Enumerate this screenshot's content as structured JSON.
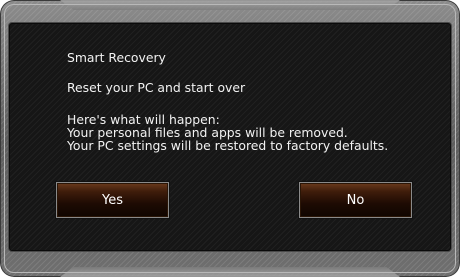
{
  "dialog": {
    "title": "Smart Recovery",
    "heading": "Reset your PC and start over",
    "lines": [
      "Here's what will happen:",
      "Your personal files and apps will be removed.",
      "Your PC settings will be restored to factory defaults."
    ]
  },
  "buttons": {
    "yes_label": "Yes",
    "no_label": "No"
  },
  "colors": {
    "panel_background": "#161616",
    "frame": "#6f6f6f",
    "button_accent": "#3f1d0b",
    "text": "#f2f2f2"
  }
}
